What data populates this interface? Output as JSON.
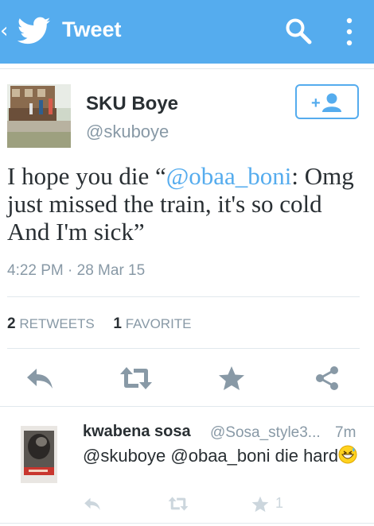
{
  "topbar": {
    "back_glyph": "‹",
    "title": "Tweet",
    "background": "#55acee"
  },
  "tweet": {
    "author_name": "SKU Boye",
    "author_handle": "@skuboye",
    "text_before": "I hope you die “",
    "mention": "@obaa_boni",
    "text_after": ": Omg just missed the train, it's so cold And I'm sick”",
    "timestamp": "4:22 PM · 28 Mar 15",
    "retweets_count": "2",
    "retweets_label": "RETWEETS",
    "favorites_count": "1",
    "favorites_label": "FAVORITE"
  },
  "actions": [
    "reply-icon",
    "retweet-icon",
    "favorite-icon",
    "share-icon"
  ],
  "reply": {
    "name": "kwabena sosa",
    "handle": "@Sosa_style3...",
    "time": "7m",
    "text": "@skuboye @obaa_boni die hard",
    "emoji": "grinning-sweat-emoji",
    "favorite_count": "1"
  },
  "colors": {
    "accent": "#55acee",
    "text": "#292f33",
    "muted": "#8899a6",
    "icon": "#8899a6",
    "icon_light": "#ccd6dd"
  }
}
